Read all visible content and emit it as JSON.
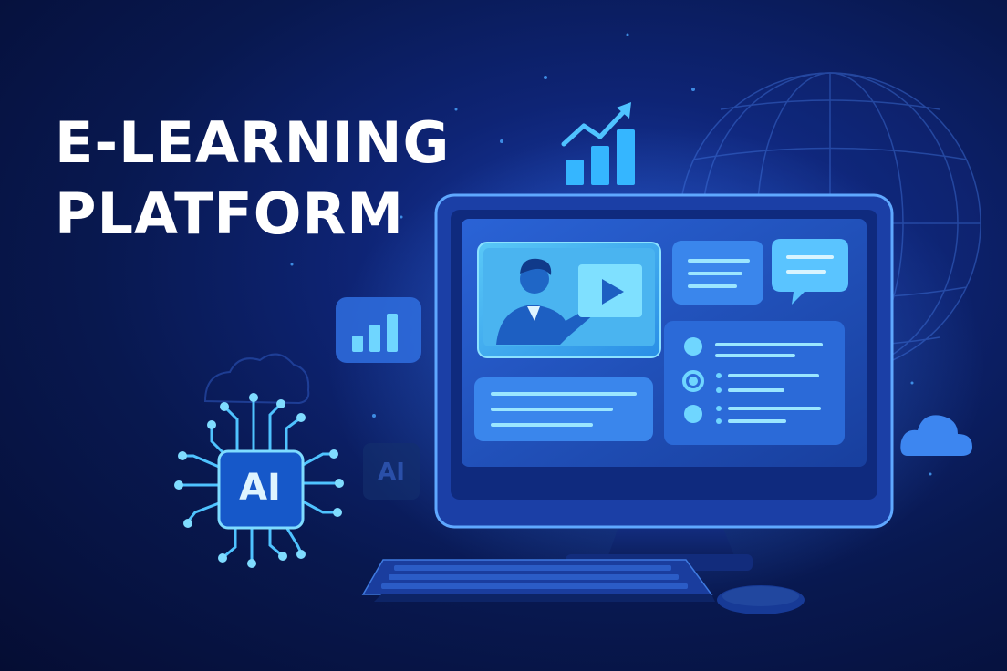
{
  "hero": {
    "title_line1": "E-LEARNING",
    "title_line2": "PLATFORM"
  },
  "badges": {
    "ai_chip_label": "AI",
    "ai_ghost_label": "AI"
  },
  "icons": [
    "growth-chart-icon",
    "bar-chart-icon",
    "ai-chip-icon",
    "globe-icon",
    "cloud-icon",
    "play-icon",
    "chat-bubble-icon"
  ],
  "colors": {
    "background": "#0a1a5c",
    "accent": "#35b6ff",
    "glow": "#4fc3ff",
    "title": "#ffffff"
  }
}
